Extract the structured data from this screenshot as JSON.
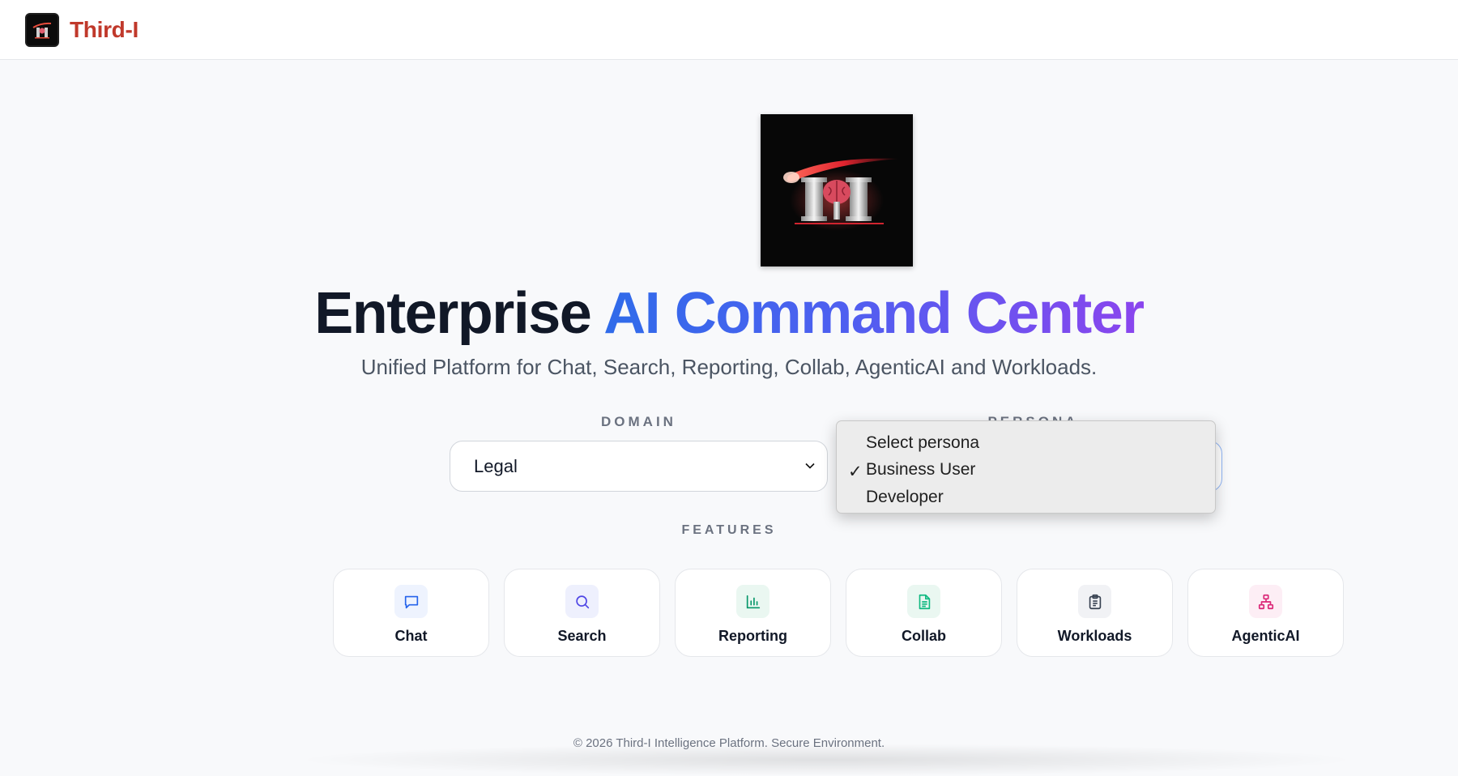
{
  "header": {
    "brand_name": "Third-I",
    "logo_icon": "third-i-logo-icon",
    "brand_color": "#c0392b"
  },
  "hero": {
    "logo_icon": "third-i-brain-logo-icon",
    "title_dark": "Enterprise",
    "title_gradient": "AI Command Center",
    "gradient_colors": [
      "#2f6bea",
      "#8b45ee"
    ],
    "subtitle": "Unified Platform for Chat, Search, Reporting, Collab, AgenticAI and Workloads."
  },
  "domain": {
    "label": "DOMAIN",
    "value": "Legal"
  },
  "persona": {
    "label": "PERSONA",
    "dropdown_open": true,
    "options": [
      {
        "label": "Select persona",
        "selected": false
      },
      {
        "label": "Business User",
        "selected": true
      },
      {
        "label": "Developer",
        "selected": false
      }
    ],
    "check_glyph": "✓"
  },
  "features": {
    "label": "FEATURES",
    "items": [
      {
        "label": "Chat",
        "icon": "chat-bubble-icon",
        "color": "#2563eb",
        "bg": "#eef3fe"
      },
      {
        "label": "Search",
        "icon": "magnifier-icon",
        "color": "#4f46e5",
        "bg": "#eef0fd"
      },
      {
        "label": "Reporting",
        "icon": "bar-chart-icon",
        "color": "#059669",
        "bg": "#eaf7f1"
      },
      {
        "label": "Collab",
        "icon": "document-icon",
        "color": "#10b981",
        "bg": "#eaf7f1"
      },
      {
        "label": "Workloads",
        "icon": "clipboard-icon",
        "color": "#374151",
        "bg": "#f1f2f5"
      },
      {
        "label": "AgenticAI",
        "icon": "network-icon",
        "color": "#db2777",
        "bg": "#fdeef5"
      }
    ]
  },
  "footer": {
    "text": "© 2026 Third-I Intelligence Platform. Secure Environment."
  }
}
